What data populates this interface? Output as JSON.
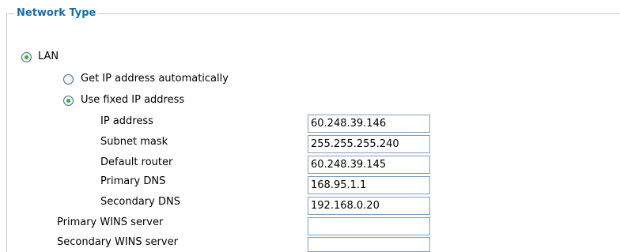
{
  "fieldset": {
    "legend": "Network Type"
  },
  "lan": {
    "label": "LAN",
    "selected": true
  },
  "ip_mode": {
    "auto_label": "Get IP address automatically",
    "auto_selected": false,
    "fixed_label": "Use fixed IP address",
    "fixed_selected": true
  },
  "fields": {
    "ip_address": {
      "label": "IP address",
      "value": "60.248.39.146"
    },
    "subnet_mask": {
      "label": "Subnet mask",
      "value": "255.255.255.240"
    },
    "default_router": {
      "label": "Default router",
      "value": "60.248.39.145"
    },
    "primary_dns": {
      "label": "Primary DNS",
      "value": "168.95.1.1"
    },
    "secondary_dns": {
      "label": "Secondary DNS",
      "value": "192.168.0.20"
    },
    "primary_wins": {
      "label": "Primary WINS server",
      "value": ""
    },
    "secondary_wins": {
      "label": "Secondary WINS server",
      "value": ""
    }
  },
  "colors": {
    "legend": "#1c6ba8",
    "radio_dot": "#3cab33",
    "input_border": "#7f9db9"
  }
}
